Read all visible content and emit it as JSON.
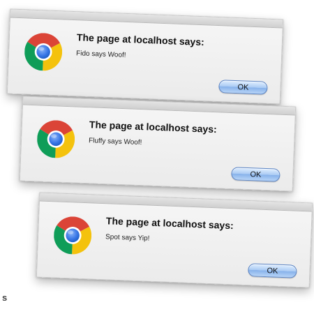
{
  "dialogs": [
    {
      "title": "The page at localhost says:",
      "message": "Fido says Woof!",
      "ok_label": "OK",
      "icon": "chrome-logo-icon"
    },
    {
      "title": "The page at localhost says:",
      "message": "Fluffy says Woof!",
      "ok_label": "OK",
      "icon": "chrome-logo-icon"
    },
    {
      "title": "The page at localhost says:",
      "message": "Spot says Yip!",
      "ok_label": "OK",
      "icon": "chrome-logo-icon"
    }
  ],
  "corner_text": "s",
  "colors": {
    "ok_button": "#a9caf3",
    "chrome_red": "#db4437",
    "chrome_yellow": "#f4c20d",
    "chrome_green": "#0f9d58",
    "chrome_blue": "#4285f4"
  }
}
